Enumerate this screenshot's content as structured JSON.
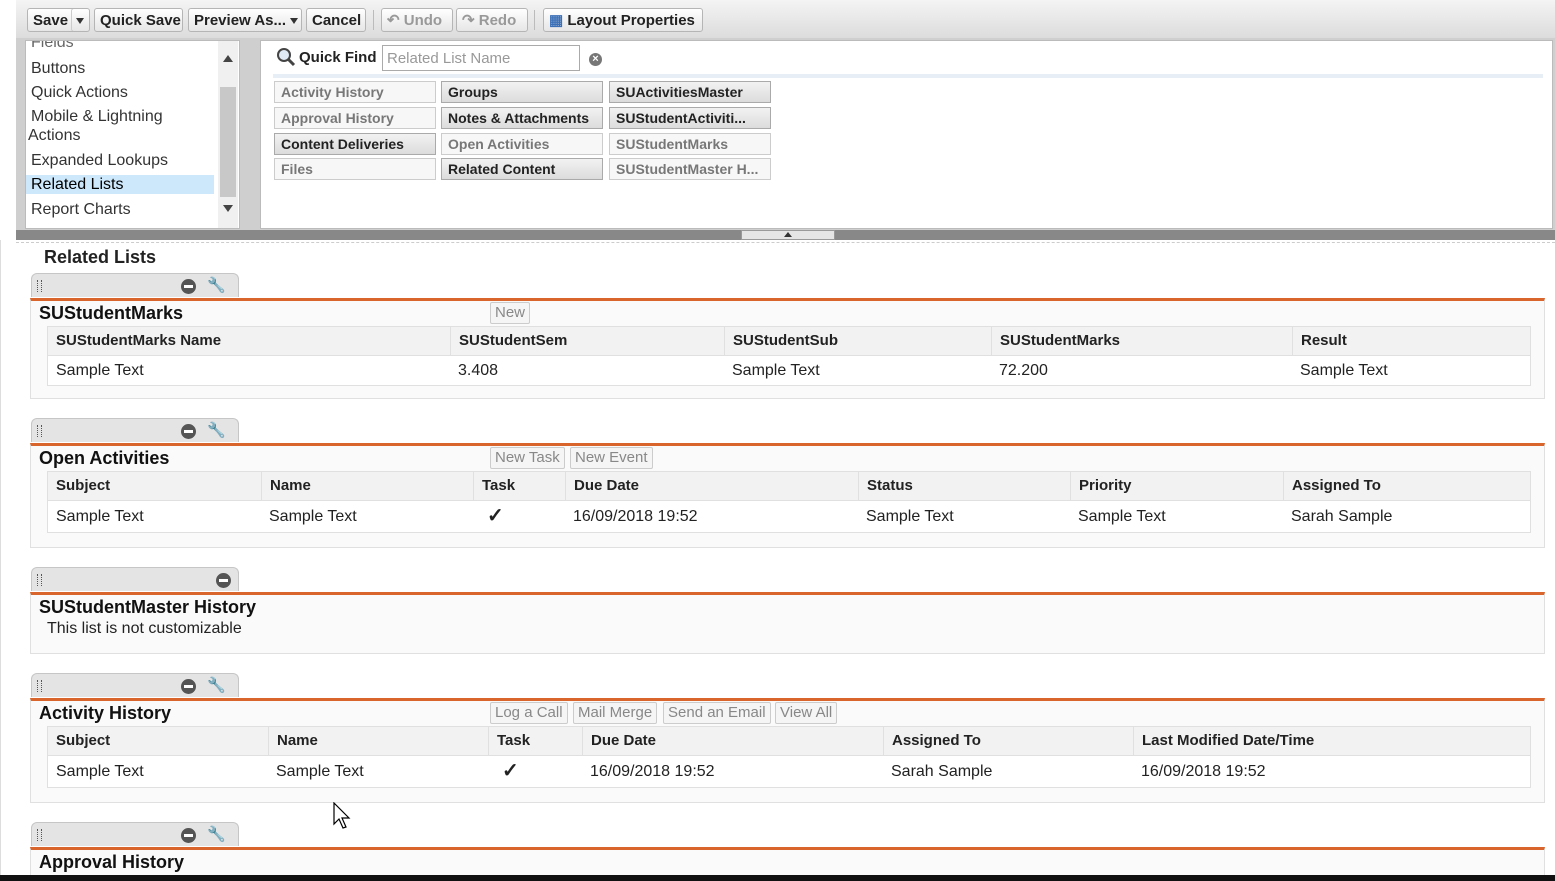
{
  "toolbar": {
    "save": "Save",
    "quick_save": "Quick Save",
    "preview_as": "Preview As...",
    "cancel": "Cancel",
    "undo": "Undo",
    "redo": "Redo",
    "layout_properties": "Layout Properties"
  },
  "categories": {
    "partial_top": "Fields",
    "items": [
      "Buttons",
      "Quick Actions",
      "Mobile & Lightning Actions",
      "Expanded Lookups",
      "Related Lists",
      "Report Charts"
    ],
    "mobile_line1": "Mobile & Lightning",
    "mobile_line2": "Actions",
    "selected": "Related Lists"
  },
  "quick_find": {
    "label": "Quick Find",
    "placeholder": "Related List Name"
  },
  "palette": {
    "items": [
      {
        "label": "Activity History",
        "state": "used"
      },
      {
        "label": "Approval History",
        "state": "used"
      },
      {
        "label": "Content Deliveries",
        "state": "available"
      },
      {
        "label": "Files",
        "state": "used"
      },
      {
        "label": "Groups",
        "state": "available"
      },
      {
        "label": "Notes & Attachments",
        "state": "available"
      },
      {
        "label": "Open Activities",
        "state": "used"
      },
      {
        "label": "Related Content",
        "state": "available"
      },
      {
        "label": "SUActivitiesMaster",
        "state": "available"
      },
      {
        "label": "SUStudentActiviti...",
        "state": "available"
      },
      {
        "label": "SUStudentMarks",
        "state": "used"
      },
      {
        "label": "SUStudentMaster H...",
        "state": "used"
      }
    ]
  },
  "main": {
    "title": "Related Lists",
    "accent_color": "#d9642c",
    "sections": [
      {
        "title": "SUStudentMarks",
        "buttons": [
          "New"
        ],
        "columns": [
          "SUStudentMarks Name",
          "SUStudentSem",
          "SUStudentSub",
          "SUStudentMarks",
          "Result"
        ],
        "row": [
          "Sample Text",
          "3.408",
          "Sample Text",
          "72.200",
          "Sample Text"
        ]
      },
      {
        "title": "Open Activities",
        "buttons": [
          "New Task",
          "New Event"
        ],
        "columns": [
          "Subject",
          "Name",
          "Task",
          "Due Date",
          "Status",
          "Priority",
          "Assigned To"
        ],
        "row": [
          "Sample Text",
          "Sample Text",
          "✓",
          "16/09/2018 19:52",
          "Sample Text",
          "Sample Text",
          "Sarah Sample"
        ]
      },
      {
        "title": "SUStudentMaster History",
        "note": "This list is not customizable"
      },
      {
        "title": "Activity History",
        "buttons": [
          "Log a Call",
          "Mail Merge",
          "Send an Email",
          "View All"
        ],
        "columns": [
          "Subject",
          "Name",
          "Task",
          "Due Date",
          "Assigned To",
          "Last Modified Date/Time"
        ],
        "row": [
          "Sample Text",
          "Sample Text",
          "✓",
          "16/09/2018 19:52",
          "Sarah Sample",
          "16/09/2018 19:52"
        ]
      },
      {
        "title": "Approval History"
      }
    ]
  }
}
